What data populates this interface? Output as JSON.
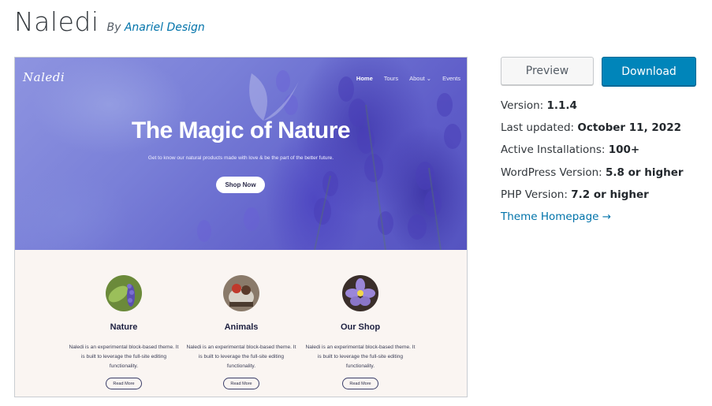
{
  "theme": {
    "name": "Naledi",
    "by": "By",
    "author": "Anariel Design"
  },
  "preview_image": {
    "logo": "Naledi",
    "nav": [
      "Home",
      "Tours",
      "About ⌄",
      "Events"
    ],
    "hero_title": "The Magic of Nature",
    "hero_subtitle": "Get to know our natural products made with love & be the part of the better future.",
    "hero_button": "Shop Now",
    "features": [
      {
        "title": "Nature",
        "text": "Naledi is an experimental block-based theme. It is built to leverage the full-site editing functionality.",
        "button": "Read More"
      },
      {
        "title": "Animals",
        "text": "Naledi is an experimental block-based theme. It is built to leverage the full-site editing functionality.",
        "button": "Read More"
      },
      {
        "title": "Our Shop",
        "text": "Naledi is an experimental block-based theme. It is built to leverage the full-site editing functionality.",
        "button": "Read More"
      }
    ]
  },
  "actions": {
    "preview": "Preview",
    "download": "Download"
  },
  "meta": {
    "version_label": "Version:",
    "version": "1.1.4",
    "updated_label": "Last updated:",
    "updated": "October 11, 2022",
    "installs_label": "Active Installations:",
    "installs": "100+",
    "wp_label": "WordPress Version:",
    "wp": "5.8 or higher",
    "php_label": "PHP Version:",
    "php": "7.2 or higher",
    "homepage": "Theme Homepage →"
  },
  "colors": {
    "accent": "#0085ba",
    "link": "#0073aa"
  }
}
